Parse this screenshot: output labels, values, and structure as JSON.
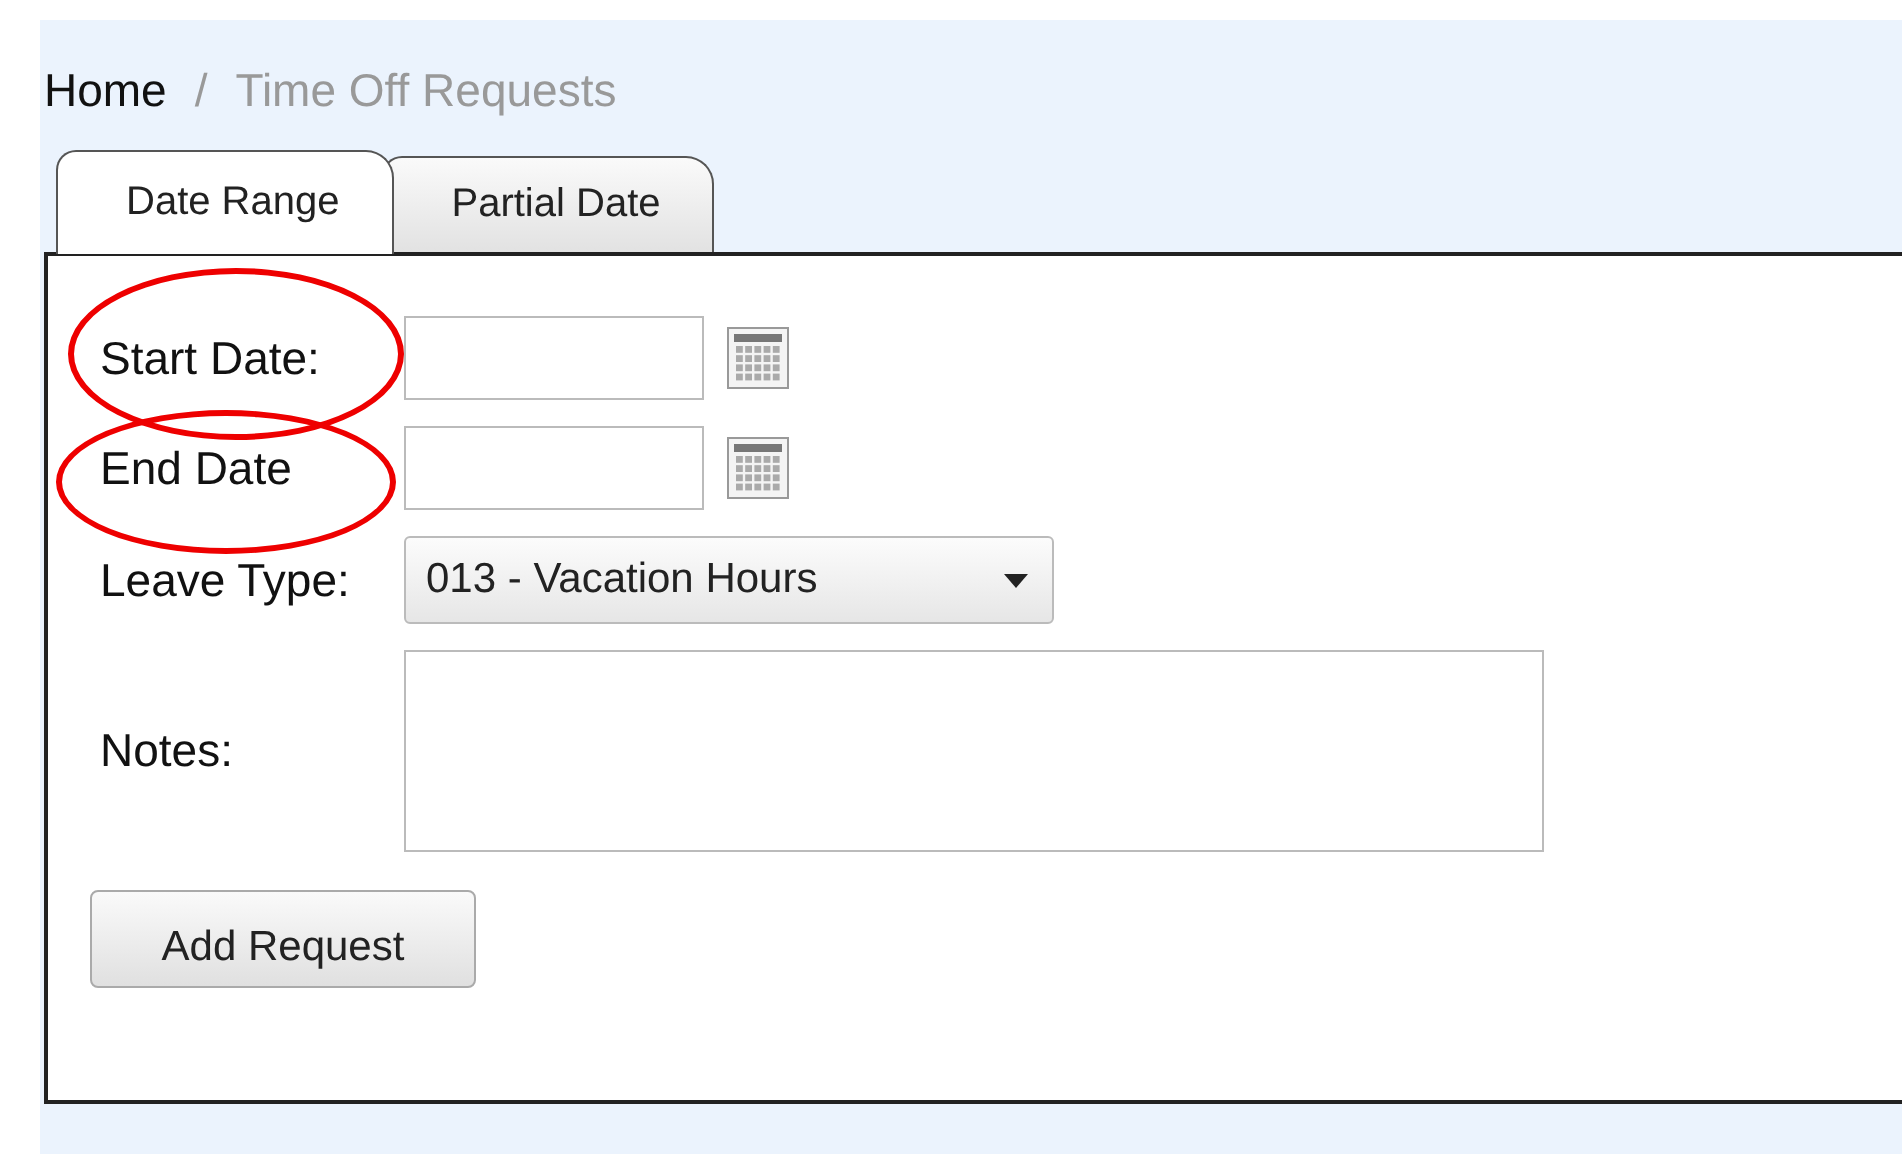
{
  "breadcrumb": [
    {
      "label": "Home",
      "current": false
    },
    {
      "label": "Time Off Requests",
      "current": true
    }
  ],
  "breadcrumb_separator": "/",
  "tabs": [
    {
      "label": "Date Range",
      "selected": true
    },
    {
      "label": "Partial Date",
      "selected": false
    }
  ],
  "fields": [
    {
      "kind": "date",
      "label": "Start Date:",
      "highlighted": true
    },
    {
      "kind": "date",
      "label": "End Date",
      "highlighted": true
    },
    {
      "kind": "select",
      "label": "Leave Type:",
      "value": "013 - Vacation Hours",
      "highlighted": false
    },
    {
      "kind": "textarea",
      "label": "Notes:",
      "highlighted": false
    }
  ],
  "button": "Add Request"
}
